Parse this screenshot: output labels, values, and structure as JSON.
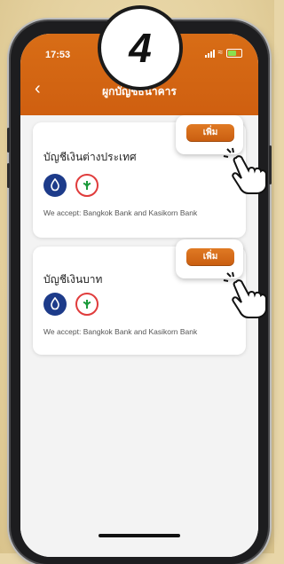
{
  "step_number": "4",
  "status_bar": {
    "time": "17:53"
  },
  "header": {
    "back_icon": "chevron-left-icon",
    "title": "ผูกบัญชีธนาคาร"
  },
  "cards": [
    {
      "title": "บัญชีเงินต่างประเทศ",
      "add_label": "เพิ่ม",
      "banks": [
        "bangkok-bank-icon",
        "kasikorn-bank-icon"
      ],
      "accept_text": "We accept: Bangkok Bank and Kasikorn Bank"
    },
    {
      "title": "บัญชีเงินบาท",
      "add_label": "เพิ่ม",
      "banks": [
        "bangkok-bank-icon",
        "kasikorn-bank-icon"
      ],
      "accept_text": "We accept: Bangkok Bank and Kasikorn Bank"
    }
  ],
  "colors": {
    "header": "#d86d16",
    "button": "#d86d16",
    "bbl": "#1d3b8a",
    "kbank": "#e03c3c"
  }
}
